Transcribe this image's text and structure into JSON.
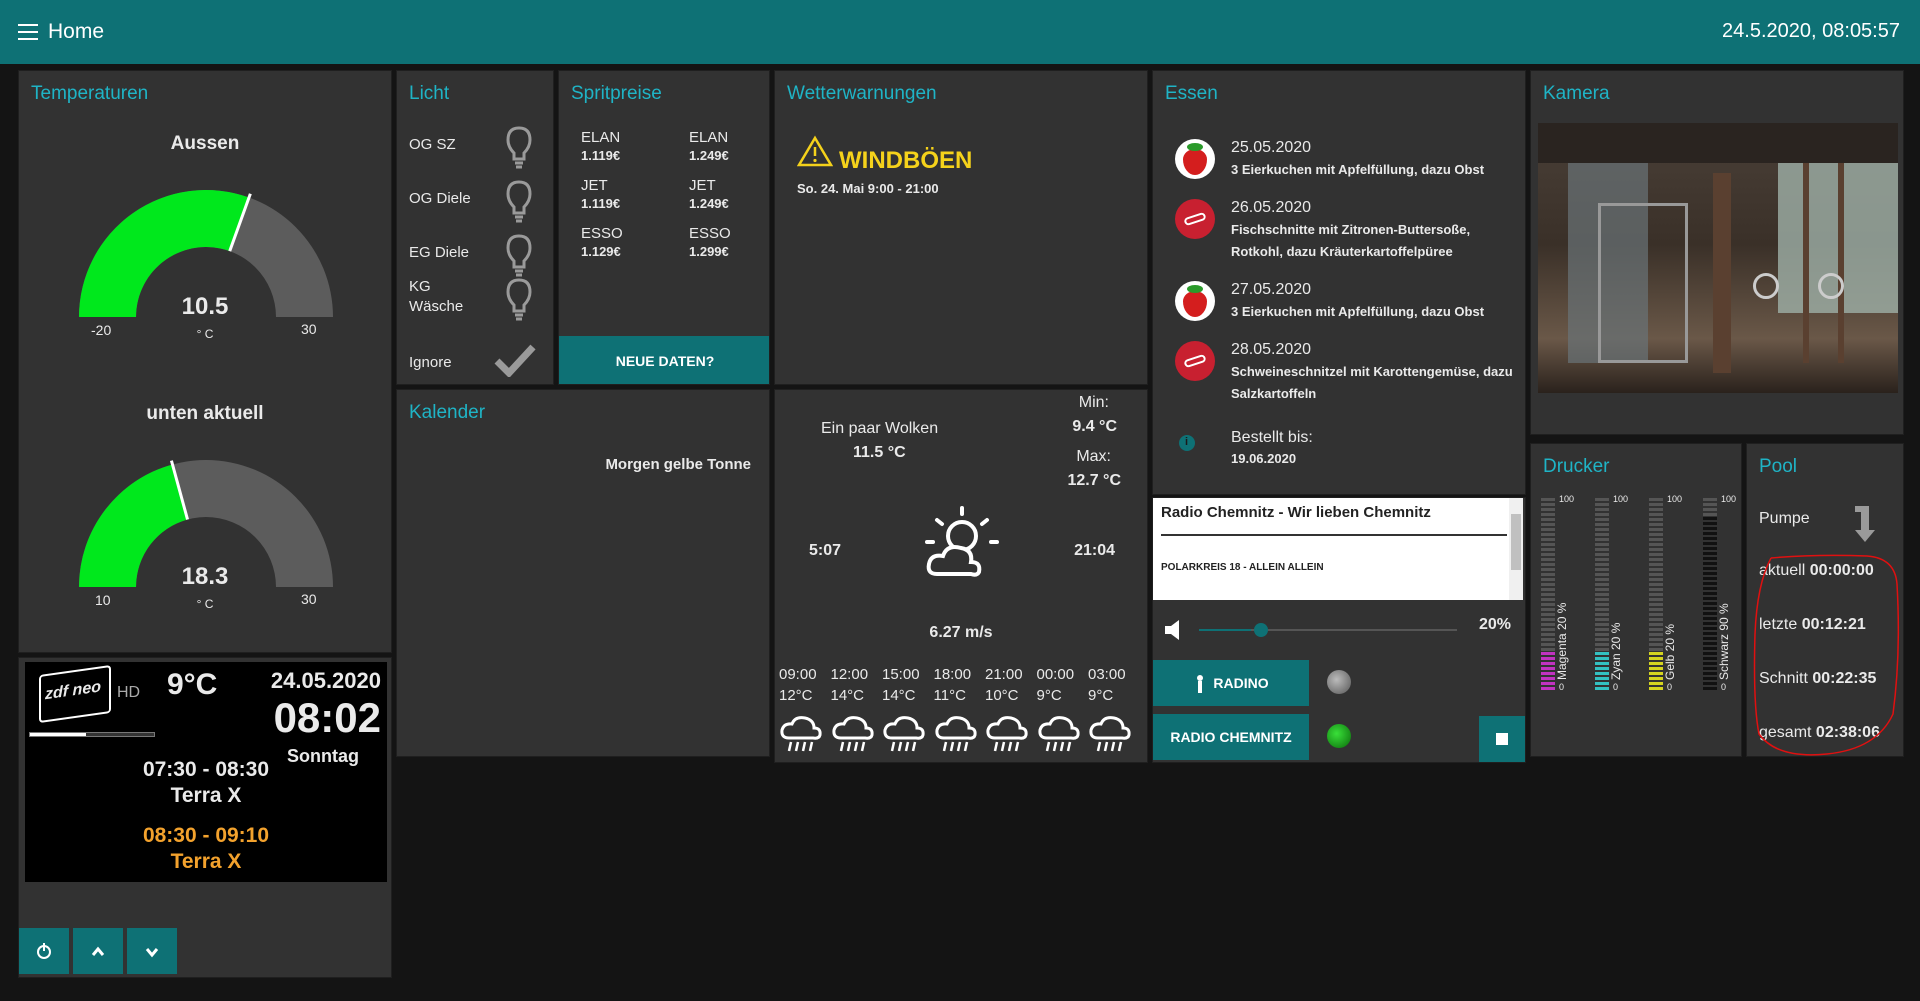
{
  "topbar": {
    "title": "Home",
    "datetime": "24.5.2020, 08:05:57"
  },
  "temperaturen": {
    "title": "Temperaturen",
    "gauges": [
      {
        "label": "Aussen",
        "value": "10.5",
        "unit": "° C",
        "min": "-20",
        "max": "30",
        "fraction": 0.61
      },
      {
        "label": "unten aktuell",
        "value": "18.3",
        "unit": "° C",
        "min": "10",
        "max": "30",
        "fraction": 0.415
      }
    ]
  },
  "licht": {
    "title": "Licht",
    "items": [
      "OG SZ",
      "OG Diele",
      "EG Diele",
      "KG\nWäsche",
      "Ignore"
    ]
  },
  "spritpreise": {
    "title": "Spritpreise",
    "left": [
      {
        "name": "ELAN",
        "price": "1.119€"
      },
      {
        "name": "JET",
        "price": "1.119€"
      },
      {
        "name": "ESSO",
        "price": "1.129€"
      }
    ],
    "right": [
      {
        "name": "ELAN",
        "price": "1.249€"
      },
      {
        "name": "JET",
        "price": "1.249€"
      },
      {
        "name": "ESSO",
        "price": "1.299€"
      }
    ],
    "button": "NEUE DATEN?"
  },
  "wetterwarnungen": {
    "title": "Wetterwarnungen",
    "warning": "WINDBÖEN",
    "time": "So. 24. Mai 9:00 - 21:00"
  },
  "essen": {
    "title": "Essen",
    "items": [
      {
        "date": "25.05.2020",
        "desc": "3 Eierkuchen mit Apfelfüllung, dazu Obst",
        "icon": "strawberry-icon"
      },
      {
        "date": "26.05.2020",
        "desc": "Fischschnitte mit Zitronen-Buttersoße, Rotkohl, dazu Kräuterkartoffelpüree",
        "icon": "fish-icon"
      },
      {
        "date": "27.05.2020",
        "desc": "3 Eierkuchen mit Apfelfüllung, dazu Obst",
        "icon": "strawberry-icon"
      },
      {
        "date": "28.05.2020",
        "desc": "Schweineschnitzel mit Karottengemüse, dazu Salzkartoffeln",
        "icon": "meat-icon"
      }
    ],
    "ordered_label": "Bestellt bis:",
    "ordered_date": "19.06.2020"
  },
  "kamera": {
    "title": "Kamera"
  },
  "kalender": {
    "title": "Kalender",
    "entry": "Morgen gelbe Tonne"
  },
  "wetter": {
    "condition": "Ein paar Wolken",
    "temp": "11.5 °C",
    "min_label": "Min:",
    "min": "9.4 °C",
    "max_label": "Max:",
    "max": "12.7 °C",
    "sunrise": "5:07",
    "sunset": "21:04",
    "wind": "6.27 m/s",
    "forecast": [
      {
        "time": "09:00",
        "temp": "12°C"
      },
      {
        "time": "12:00",
        "temp": "14°C"
      },
      {
        "time": "15:00",
        "temp": "14°C"
      },
      {
        "time": "18:00",
        "temp": "11°C"
      },
      {
        "time": "21:00",
        "temp": "10°C"
      },
      {
        "time": "00:00",
        "temp": "9°C"
      },
      {
        "time": "03:00",
        "temp": "9°C"
      }
    ]
  },
  "radio": {
    "station": "Radio Chemnitz - Wir lieben Chemnitz",
    "song": "POLARKREIS 18 - ALLEIN ALLEIN",
    "volume": "20%",
    "volume_fraction": 0.2,
    "btn_radino": "RADINO",
    "btn_chemnitz": "RADIO CHEMNITZ"
  },
  "drucker": {
    "title": "Drucker",
    "channels": [
      {
        "name": "Magenta 20 %",
        "max": "100",
        "min": "0",
        "level": 0.2,
        "color": "#c133c1"
      },
      {
        "name": "Zyan 20 %",
        "max": "100",
        "min": "0",
        "level": 0.2,
        "color": "#33c1c1"
      },
      {
        "name": "Gelb 20 %",
        "max": "100",
        "min": "0",
        "level": 0.2,
        "color": "#d4d420"
      },
      {
        "name": "Schwarz 90 %",
        "max": "100",
        "min": "0",
        "level": 0.9,
        "color": "#111111"
      }
    ]
  },
  "pool": {
    "title": "Pool",
    "pumpe": "Pumpe",
    "rows": [
      {
        "label": "aktuell",
        "value": "00:00:00"
      },
      {
        "label": "letzte",
        "value": "00:12:21"
      },
      {
        "label": "Schnitt",
        "value": "00:22:35"
      },
      {
        "label": "gesamt",
        "value": "02:38:06"
      }
    ]
  },
  "tv": {
    "channel_logo": "zdf neo",
    "channel_hd": "HD",
    "temp": "9°C",
    "date": "24.05.2020",
    "time": "08:02",
    "day": "Sonntag",
    "now_time": "07:30 - 08:30",
    "now_title": "Terra X",
    "next_time": "08:30 - 09:10",
    "next_title": "Terra X",
    "progress": 0.45
  },
  "colors": {
    "accent": "#0e7175",
    "title": "#1fb4c6",
    "gauge": "#00e81c",
    "warn": "#f5d21b",
    "next": "#f3a22d"
  }
}
